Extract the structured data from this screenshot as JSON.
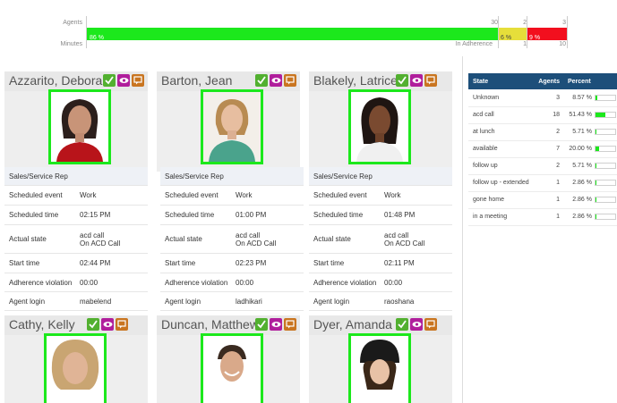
{
  "adherence": {
    "agents_label": "Agents",
    "minutes_label": "Minutes",
    "agents_in": "30",
    "agents_mid": "2",
    "agents_out": "3",
    "green_pct": "86 %",
    "yellow_pct": "6 %",
    "red_pct": "9 %",
    "in_adherence_label": "In Adherence",
    "minutes_mid": "1",
    "minutes_out": "10",
    "colors": {
      "in": "#1ce81c",
      "warn": "#e6de3a",
      "out": "#f20f1e"
    }
  },
  "row_labels": {
    "scheduled_event": "Scheduled event",
    "scheduled_time": "Scheduled time",
    "actual_state": "Actual state",
    "start_time": "Start time",
    "adherence_violation": "Adherence violation",
    "agent_login": "Agent login"
  },
  "agents": [
    {
      "name": "Azzarito, Deborah",
      "role": "Sales/Service Rep",
      "scheduled_event": "Work",
      "scheduled_time": "02:15 PM",
      "state_line1": "acd call",
      "state_line2": "On ACD Call",
      "start_time": "02:44 PM",
      "adherence_violation": "00:00",
      "login": "mabelend"
    },
    {
      "name": "Barton, Jean",
      "role": "Sales/Service Rep",
      "scheduled_event": "Work",
      "scheduled_time": "01:00 PM",
      "state_line1": "acd call",
      "state_line2": "On ACD Call",
      "start_time": "02:23 PM",
      "adherence_violation": "00:00",
      "login": "ladhikari"
    },
    {
      "name": "Blakely, Latrice",
      "role": "Sales/Service Rep",
      "scheduled_event": "Work",
      "scheduled_time": "01:48 PM",
      "state_line1": "acd call",
      "state_line2": "On ACD Call",
      "start_time": "02:11 PM",
      "adherence_violation": "00:00",
      "login": "raoshana"
    },
    {
      "name": "Cathy, Kelly"
    },
    {
      "name": "Duncan, Matthew"
    },
    {
      "name": "Dyer, Amanda"
    }
  ],
  "stats": {
    "headers": {
      "state": "State",
      "agents": "Agents",
      "percent": "Percent"
    },
    "rows": [
      {
        "state": "Unknown",
        "agents": "3",
        "percent": "8.57 %",
        "fill": 0.0857
      },
      {
        "state": "acd call",
        "agents": "18",
        "percent": "51.43 %",
        "fill": 0.5143
      },
      {
        "state": "at lunch",
        "agents": "2",
        "percent": "5.71 %",
        "fill": 0.0571
      },
      {
        "state": "available",
        "agents": "7",
        "percent": "20.00 %",
        "fill": 0.2
      },
      {
        "state": "follow up",
        "agents": "2",
        "percent": "5.71 %",
        "fill": 0.0571
      },
      {
        "state": "follow up - extended",
        "agents": "1",
        "percent": "2.86 %",
        "fill": 0.0286
      },
      {
        "state": "gone home",
        "agents": "1",
        "percent": "2.86 %",
        "fill": 0.0286
      },
      {
        "state": "in a meeting",
        "agents": "1",
        "percent": "2.86 %",
        "fill": 0.0286
      }
    ]
  }
}
